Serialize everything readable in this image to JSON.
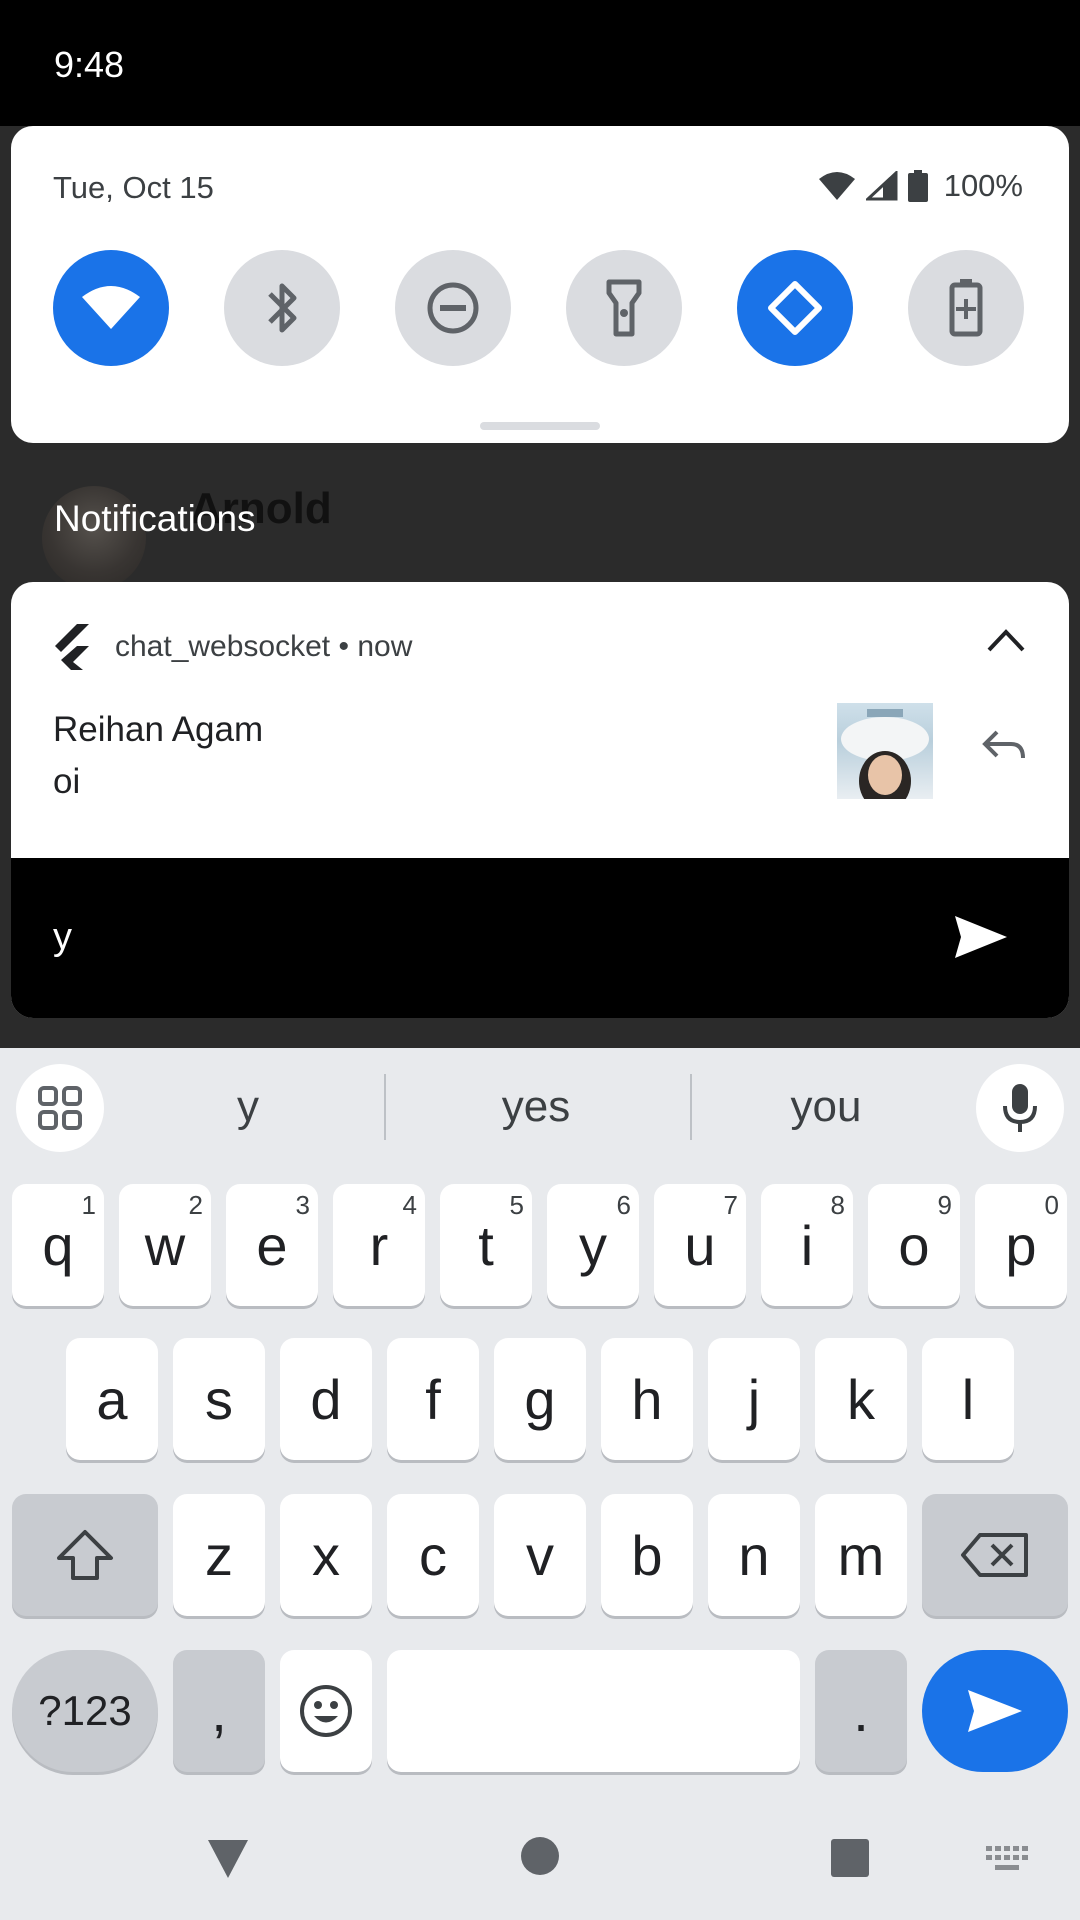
{
  "status_bar": {
    "time": "9:48"
  },
  "quick_settings": {
    "date": "Tue, Oct 15",
    "battery_percent": "100%",
    "tiles": [
      {
        "name": "wifi",
        "on": true
      },
      {
        "name": "bluetooth",
        "on": false
      },
      {
        "name": "do-not-disturb",
        "on": false
      },
      {
        "name": "flashlight",
        "on": false
      },
      {
        "name": "auto-rotate",
        "on": true
      },
      {
        "name": "battery-saver",
        "on": false
      }
    ]
  },
  "behind": {
    "contact_name": "Arnold"
  },
  "notifications": {
    "header_label": "Notifications",
    "card": {
      "app_name": "chat_websocket",
      "separator": "•",
      "time": "now",
      "title": "Reihan Agam",
      "body": "oi",
      "reply_text": "y"
    }
  },
  "keyboard": {
    "suggestions": [
      "y",
      "yes",
      "you"
    ],
    "row1": [
      {
        "k": "q",
        "h": "1"
      },
      {
        "k": "w",
        "h": "2"
      },
      {
        "k": "e",
        "h": "3"
      },
      {
        "k": "r",
        "h": "4"
      },
      {
        "k": "t",
        "h": "5"
      },
      {
        "k": "y",
        "h": "6"
      },
      {
        "k": "u",
        "h": "7"
      },
      {
        "k": "i",
        "h": "8"
      },
      {
        "k": "o",
        "h": "9"
      },
      {
        "k": "p",
        "h": "0"
      }
    ],
    "row2": [
      "a",
      "s",
      "d",
      "f",
      "g",
      "h",
      "j",
      "k",
      "l"
    ],
    "row3": [
      "z",
      "x",
      "c",
      "v",
      "b",
      "n",
      "m"
    ],
    "symbols_label": "?123",
    "comma_label": ",",
    "period_label": "."
  },
  "colors": {
    "accent": "#1a73e8",
    "key_mod": "#c8cbd0"
  }
}
